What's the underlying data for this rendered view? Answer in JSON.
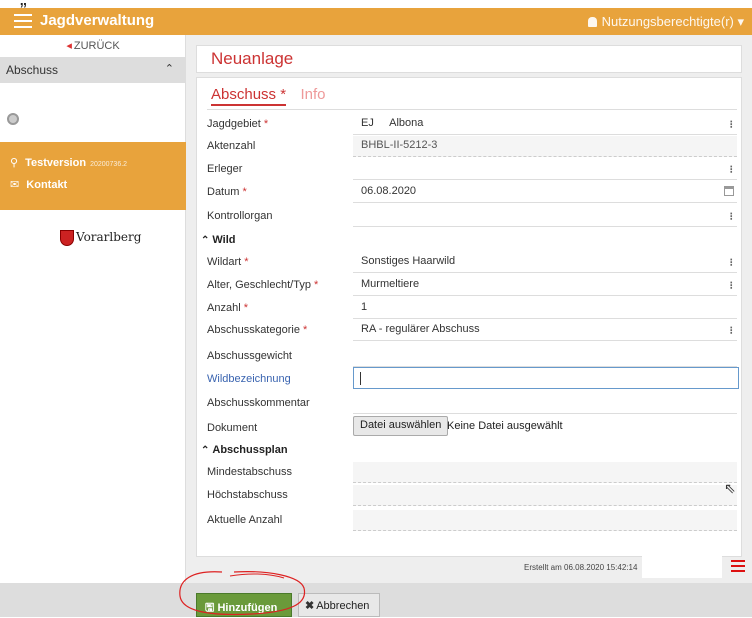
{
  "app": {
    "title": "Jagdverwaltung",
    "user_label": "Nutzungsberechtigte(r)"
  },
  "sidebar": {
    "back_label": "ZURÜCK",
    "section_label": "Abschuss",
    "test_label": "Testversion",
    "version": "20200736.2",
    "contact_label": "Kontakt",
    "logo_text": "Vorarlberg"
  },
  "page": {
    "title": "Neuanlage",
    "tabs": [
      "Abschuss *",
      "Info"
    ]
  },
  "form": {
    "jagdgebiet_label": "Jagdgebiet",
    "jagdgebiet_prefix": "EJ",
    "jagdgebiet_value": "Albona",
    "aktenzahl_label": "Aktenzahl",
    "aktenzahl_value": "BHBL-II-5212-3",
    "erleger_label": "Erleger",
    "datum_label": "Datum",
    "datum_value": "06.08.2020",
    "kontrollorgan_label": "Kontrollorgan",
    "wild_section": "Wild",
    "wildart_label": "Wildart",
    "wildart_value": "Sonstiges Haarwild",
    "alter_label": "Alter, Geschlecht/Typ",
    "alter_value": "Murmeltiere",
    "anzahl_label": "Anzahl",
    "anzahl_value": "1",
    "kategorie_label": "Abschusskategorie",
    "kategorie_value": "RA - regulärer Abschuss",
    "gewicht_label": "Abschussgewicht",
    "wildbez_label": "Wildbezeichnung",
    "kommentar_label": "Abschusskommentar",
    "dokument_label": "Dokument",
    "file_button": "Datei auswählen",
    "file_status": "Keine Datei ausgewählt",
    "plan_section": "Abschussplan",
    "mindest_label": "Mindestabschuss",
    "hoechst_label": "Höchstabschuss",
    "aktuell_label": "Aktuelle Anzahl",
    "required_mark": "*"
  },
  "footer": {
    "created": "Erstellt am 06.08.2020 15:42:14"
  },
  "actions": {
    "add_label": "Hinzufügen",
    "cancel_label": "Abbrechen"
  },
  "colors": {
    "header": "#e8a33c",
    "accent": "#cc3333",
    "add_button": "#6a9a3a"
  },
  "icons": [
    "menu-icon",
    "user-icon",
    "back-arrow-icon",
    "chevron-up-icon",
    "user-circle-icon",
    "pin-icon",
    "mail-icon",
    "kebab-menu-icon",
    "calendar-icon",
    "save-icon",
    "close-icon",
    "list-icon"
  ]
}
